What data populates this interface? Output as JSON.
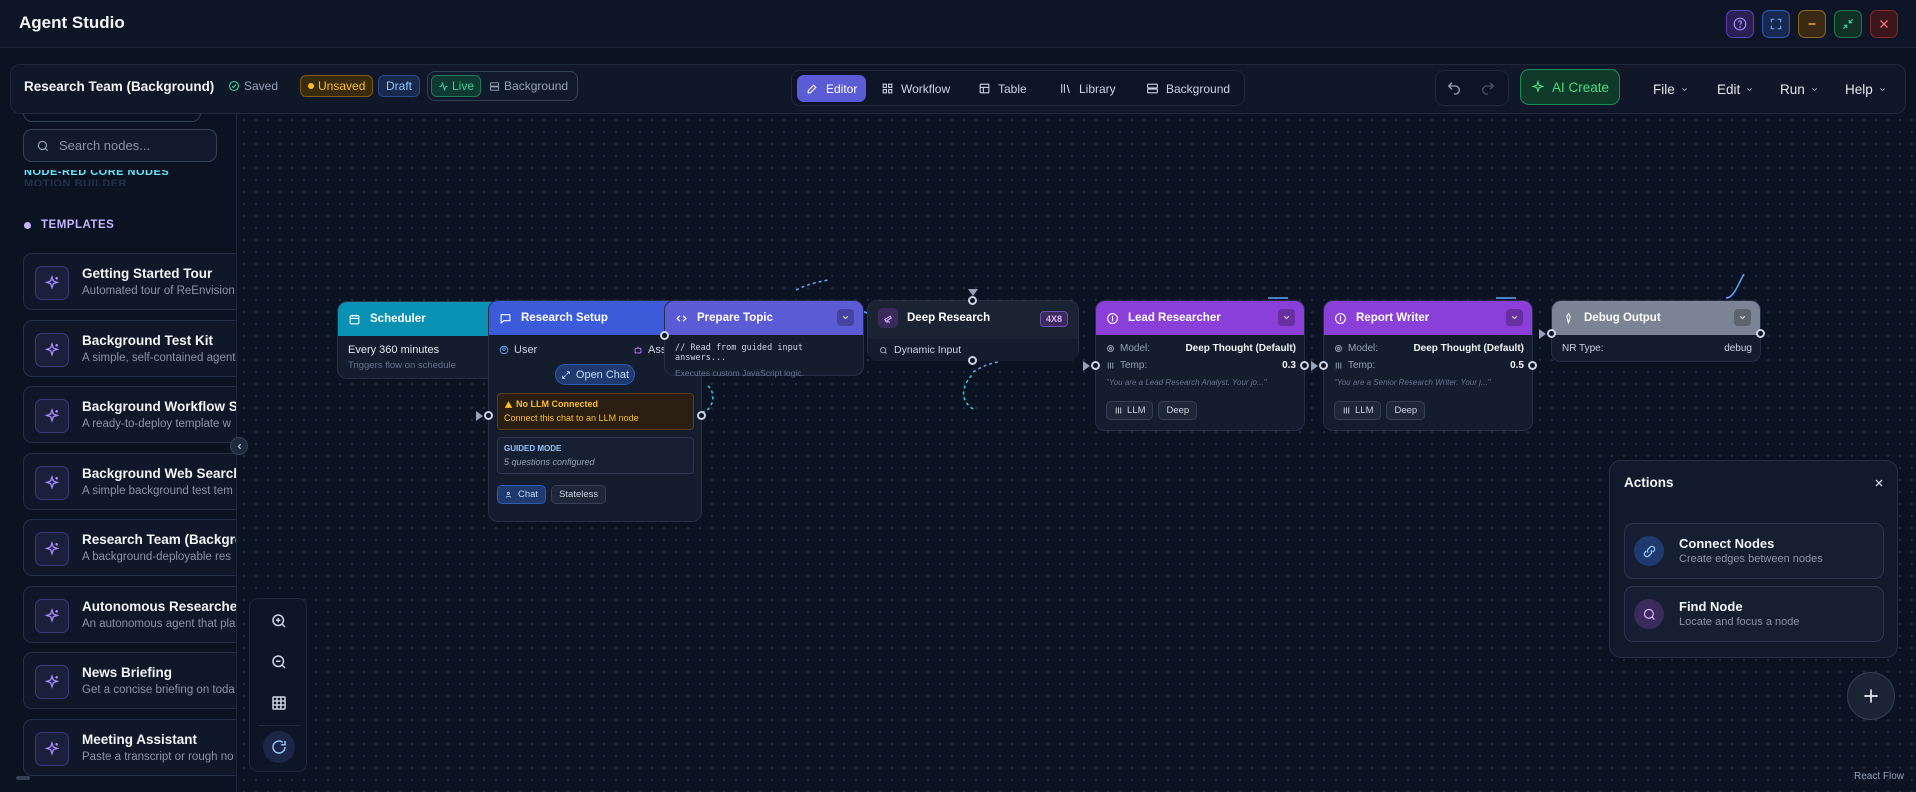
{
  "app": {
    "title": "Agent Studio"
  },
  "toolbar": {
    "project_name": "Research Team (Background)",
    "saved_label": "Saved",
    "unsaved_label": "Unsaved",
    "draft_label": "Draft",
    "live_label": "Live",
    "background_label": "Background",
    "tabs": [
      {
        "label": "Editor",
        "active": true
      },
      {
        "label": "Workflow",
        "active": false
      },
      {
        "label": "Table",
        "active": false
      },
      {
        "label": "Library",
        "active": false
      },
      {
        "label": "Background",
        "active": false
      }
    ],
    "ai_create_label": "AI Create",
    "menus": [
      "File",
      "Edit",
      "Run",
      "Help"
    ]
  },
  "sidebar": {
    "search_placeholder": "Search nodes...",
    "cut_items": [
      "NODE-RED CORE NODES",
      "MOTION BUILDER"
    ],
    "templates_heading": "TEMPLATES",
    "templates": [
      {
        "title": "Getting Started Tour",
        "desc": "Automated tour of ReEnvision"
      },
      {
        "title": "Background Test Kit",
        "desc": "A simple, self-contained agent"
      },
      {
        "title": "Background Workflow St",
        "desc": "A ready-to-deploy template w"
      },
      {
        "title": "Background Web Search",
        "desc": "A simple background test tem"
      },
      {
        "title": "Research Team (Backgro",
        "desc": "A background-deployable res"
      },
      {
        "title": "Autonomous Researcher",
        "desc": "An autonomous agent that pla"
      },
      {
        "title": "News Briefing",
        "desc": "Get a concise briefing on toda"
      },
      {
        "title": "Meeting Assistant",
        "desc": "Paste a transcript or rough no"
      }
    ]
  },
  "nodes": {
    "scheduler": {
      "title": "Scheduler",
      "line1": "Every 360 minutes",
      "line2": "Triggers flow on schedule"
    },
    "research_setup": {
      "title": "Research Setup",
      "user_label": "User",
      "assistant_label": "Ass",
      "open_chat": "Open Chat",
      "warning_title": "No LLM Connected",
      "warning_text": "Connect this chat to an LLM node",
      "guided_title": "GUIDED MODE",
      "guided_text": "5 questions configured",
      "pills": [
        "Chat",
        "Stateless"
      ]
    },
    "prepare_topic": {
      "title": "Prepare Topic",
      "code": "// Read from guided input answers...",
      "desc": "Executes custom JavaScript logic."
    },
    "deep_research": {
      "title": "Deep Research",
      "badge": "4X8",
      "input_label": "Dynamic Input"
    },
    "lead_researcher": {
      "title": "Lead Researcher",
      "model_label": "Model:",
      "model_value": "Deep Thought (Default)",
      "temp_label": "Temp:",
      "temp_value": "0.3",
      "prompt": "\"You are a Lead Research Analyst. Your jo...\"",
      "pills": [
        "LLM",
        "Deep"
      ]
    },
    "report_writer": {
      "title": "Report Writer",
      "model_label": "Model:",
      "model_value": "Deep Thought (Default)",
      "temp_label": "Temp:",
      "temp_value": "0.5",
      "prompt": "\"You are a Senior Research Writer. Your j...\"",
      "pills": [
        "LLM",
        "Deep"
      ]
    },
    "debug_output": {
      "title": "Debug Output",
      "type_label": "NR Type:",
      "type_value": "debug"
    }
  },
  "actions": {
    "title": "Actions",
    "items": [
      {
        "title": "Connect Nodes",
        "desc": "Create edges between nodes"
      },
      {
        "title": "Find Node",
        "desc": "Locate and focus a node"
      }
    ]
  },
  "attribution": "React Flow",
  "colors": {
    "accent": "#5b5bd6",
    "scheduler": "#0891b2",
    "research_setup": "#3b5bdb",
    "prepare_topic": "#5b5bd6",
    "llm_node": "#8b3fd9",
    "debug": "#7b8494",
    "ai_create": "#22c55e",
    "unsaved": "#f59e0b"
  }
}
